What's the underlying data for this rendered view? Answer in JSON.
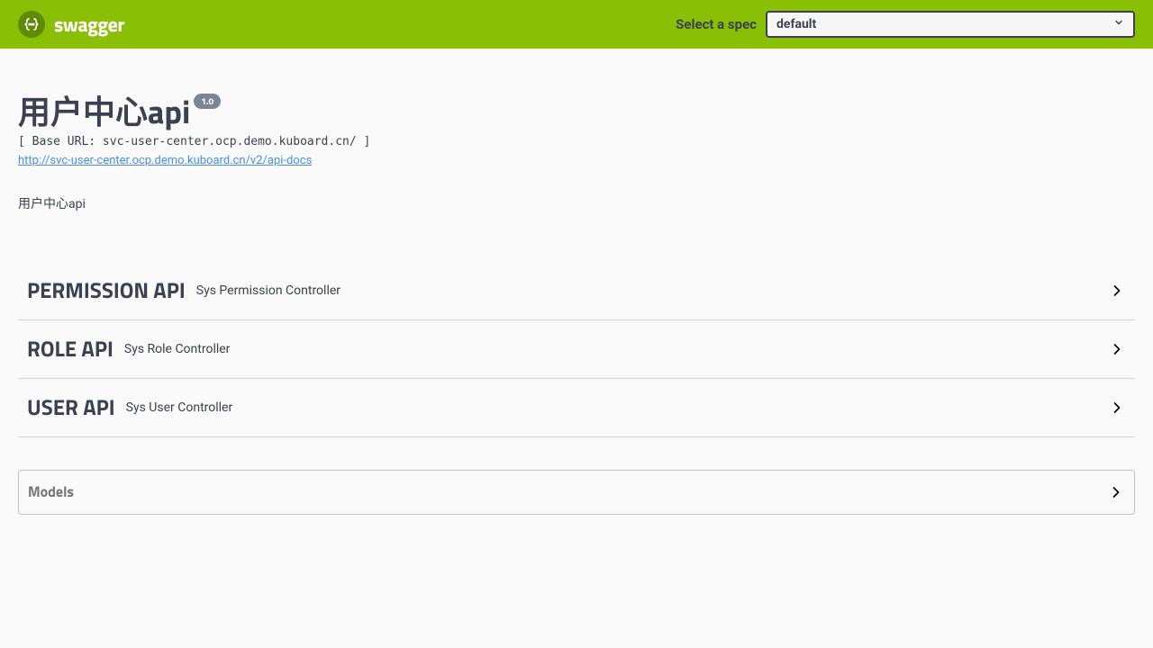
{
  "topbar": {
    "brand": "swagger",
    "spec_label": "Select a spec",
    "spec_selected": "default"
  },
  "info": {
    "title": "用户中心api",
    "version": "1.0",
    "base_url_line": "[ Base URL: svc-user-center.ocp.demo.kuboard.cn/ ]",
    "docs_url": "http://svc-user-center.ocp.demo.kuboard.cn/v2/api-docs",
    "description": "用户中心api"
  },
  "tags": [
    {
      "name": "PERMISSION API",
      "desc": "Sys Permission Controller"
    },
    {
      "name": "ROLE API",
      "desc": "Sys Role Controller"
    },
    {
      "name": "USER API",
      "desc": "Sys User Controller"
    }
  ],
  "models": {
    "title": "Models"
  }
}
